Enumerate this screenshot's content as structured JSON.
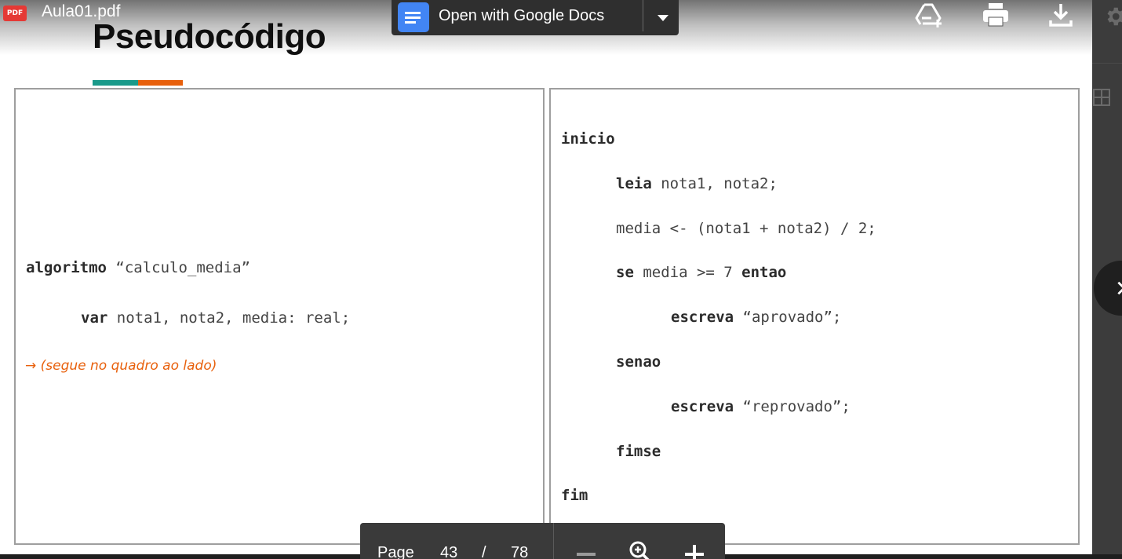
{
  "file_header": {
    "badge_text": "PDF",
    "file_name": "Aula01.pdf"
  },
  "open_with": {
    "label": "Open with Google Docs",
    "icon": "google-docs-icon",
    "dropdown_icon": "caret-down-icon"
  },
  "toolbar_icons": [
    {
      "name": "add-to-drive-icon"
    },
    {
      "name": "print-icon"
    },
    {
      "name": "download-icon"
    }
  ],
  "slide": {
    "title": "Pseudocódigo",
    "accent_colors": [
      "#1a9a8a",
      "#e8600c"
    ],
    "left_box": {
      "lines": [
        {
          "keyword": "algoritmo",
          "rest": " “calculo_media”"
        },
        {
          "keyword": "var",
          "rest": " nota1, nota2, media: real;"
        }
      ],
      "note": "→ (segue no quadro ao lado)"
    },
    "right_box": {
      "lines": [
        {
          "keyword": "inicio",
          "rest": ""
        },
        {
          "keyword": "leia",
          "rest": " nota1, nota2;"
        },
        {
          "keyword": "",
          "rest": "media <- (nota1 + nota2) / 2;"
        },
        {
          "keyword": "se",
          "rest": " media >= 7 ",
          "keyword2": "entao"
        },
        {
          "keyword": "escreva",
          "rest": " “aprovado”;"
        },
        {
          "keyword": "senao",
          "rest": ""
        },
        {
          "keyword": "escreva",
          "rest": " “reprovado”;"
        },
        {
          "keyword": "fimse",
          "rest": ""
        },
        {
          "keyword": "fim",
          "rest": ""
        }
      ]
    }
  },
  "page_controls": {
    "page_label": "Page",
    "current_page": "43",
    "separator": "/",
    "total_pages": "78",
    "zoom_out_icon": "minus-icon",
    "zoom_reset_icon": "zoom-icon",
    "zoom_in_icon": "plus-icon"
  },
  "side": {
    "settings_icon": "gear-icon",
    "grid_icon": "grid-icon",
    "next_icon": "chevron-right-icon"
  },
  "colors": {
    "note_orange": "#e8600c",
    "teal": "#1a9a8a",
    "docs_blue": "#4285f4",
    "pdf_red": "#e53935"
  }
}
